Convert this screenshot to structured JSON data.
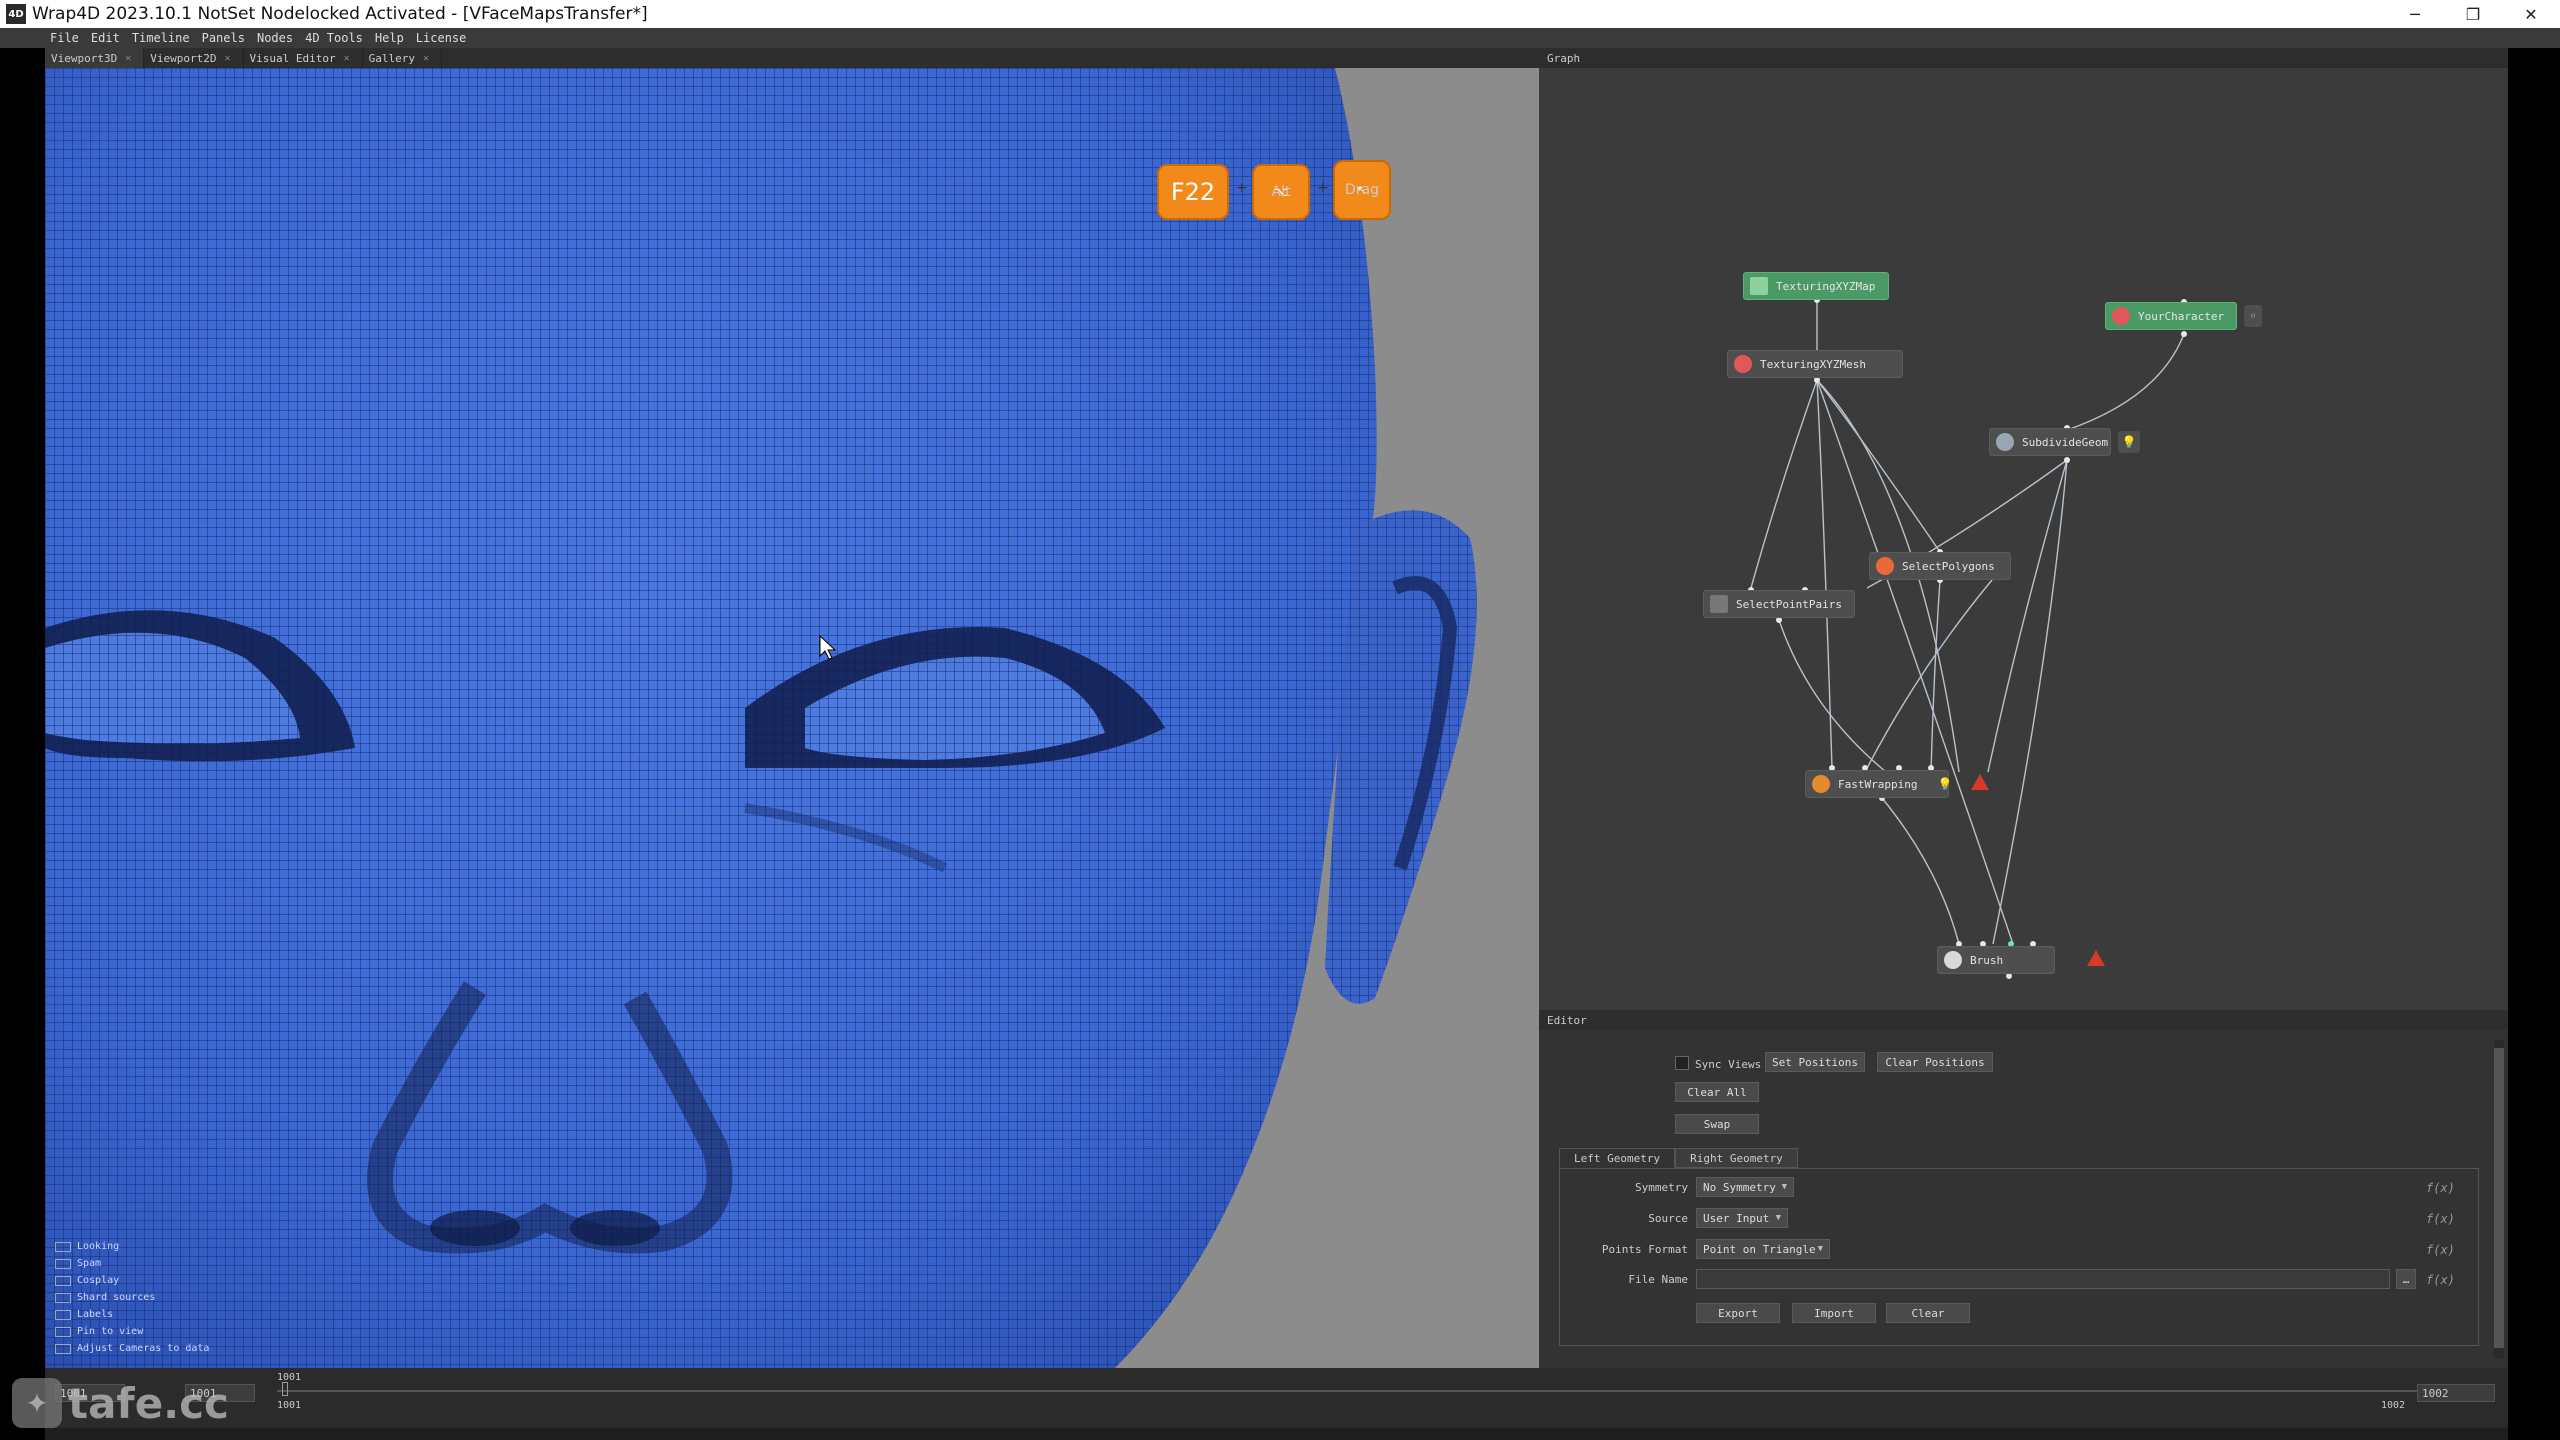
{
  "window": {
    "logo": "4D",
    "title": "Wrap4D 2023.10.1   NotSet Nodelocked Activated  - [VFaceMapsTransfer*]",
    "minimize": "─",
    "restore": "❐",
    "close": "✕"
  },
  "menu": [
    "File",
    "Edit",
    "Timeline",
    "Panels",
    "Nodes",
    "4D Tools",
    "Help",
    "License"
  ],
  "tabs": [
    {
      "label": "Viewport3D",
      "active": true
    },
    {
      "label": "Viewport2D",
      "active": false
    },
    {
      "label": "Visual Editor",
      "active": false
    },
    {
      "label": "Gallery",
      "active": false
    }
  ],
  "keycast": {
    "key1": "F22",
    "key2_symbol": "⌥",
    "key2": "Alt",
    "key3_symbol": "↖",
    "key3": "Drag",
    "plus": "+"
  },
  "viewport_overlay": [
    {
      "label": "Looking"
    },
    {
      "label": "Spam"
    },
    {
      "label": "Cosplay"
    },
    {
      "label": "Shard sources"
    },
    {
      "label": "Labels"
    },
    {
      "label": "Pin to view"
    },
    {
      "label": "Adjust Cameras to data"
    }
  ],
  "graph": {
    "header": "Graph",
    "nodes": {
      "texturing_map": "TexturingXYZMap",
      "texturing_mesh": "TexturingXYZMesh",
      "your_character": "YourCharacter",
      "subdivide": "SubdivideGeom",
      "select_polygons": "SelectPolygons",
      "select_point_pairs": "SelectPointPairs",
      "fast_wrapping": "FastWrapping",
      "brush": "Brush"
    }
  },
  "editor": {
    "header": "Editor",
    "sync_views": "Sync Views",
    "set_positions": "Set Positions",
    "clear_positions": "Clear Positions",
    "clear_all": "Clear All",
    "swap": "Swap",
    "tab_left": "Left Geometry",
    "tab_right": "Right Geometry",
    "symmetry_label": "Symmetry",
    "symmetry_value": "No Symmetry",
    "source_label": "Source",
    "source_value": "User Input",
    "points_format_label": "Points Format",
    "points_format_value": "Point on Triangle",
    "file_name_label": "File Name",
    "file_name_value": "",
    "export": "Export",
    "import": "Import",
    "clear": "Clear",
    "fx": "f(x)"
  },
  "timeline": {
    "start_field": "1001",
    "current_field": "1001",
    "ruler_start": "1001",
    "ruler_end": "1002",
    "marker_top": "1001",
    "end_field": "1002"
  },
  "watermark": "tafe.cc"
}
